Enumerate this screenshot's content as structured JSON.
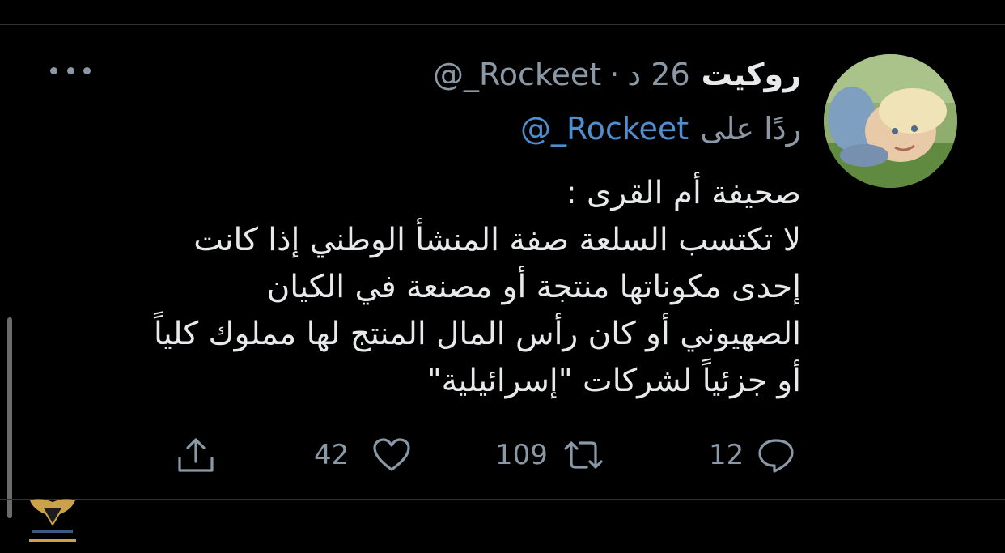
{
  "tweet": {
    "display_name": "روكيت",
    "handle": "@_Rockeet",
    "separator": "·",
    "time": "26 د",
    "reply_prefix": "ردًا على",
    "reply_handle": "@_Rockeet",
    "lines": [
      "صحيفة أم القرى :",
      "لا تكتسب السلعة صفة المنشأ الوطني إذا كانت",
      "إحدى مكوناتها منتجة أو مصنعة في الكيان",
      "الصهيوني أو كان رأس المال المنتج لها مملوك كلياً",
      "أو جزئياً لشركات \"إسرائيلية\""
    ]
  },
  "actions": {
    "reply_count": "12",
    "retweet_count": "109",
    "like_count": "42"
  },
  "icons": {
    "reply": "reply-icon",
    "retweet": "retweet-icon",
    "like": "heart-icon",
    "share": "share-icon",
    "more": "more-icon"
  },
  "colors": {
    "background": "#000000",
    "text": "#e7e9ea",
    "secondary": "#8b98a5",
    "link": "#4f8fd0",
    "divider": "#2f3336"
  }
}
